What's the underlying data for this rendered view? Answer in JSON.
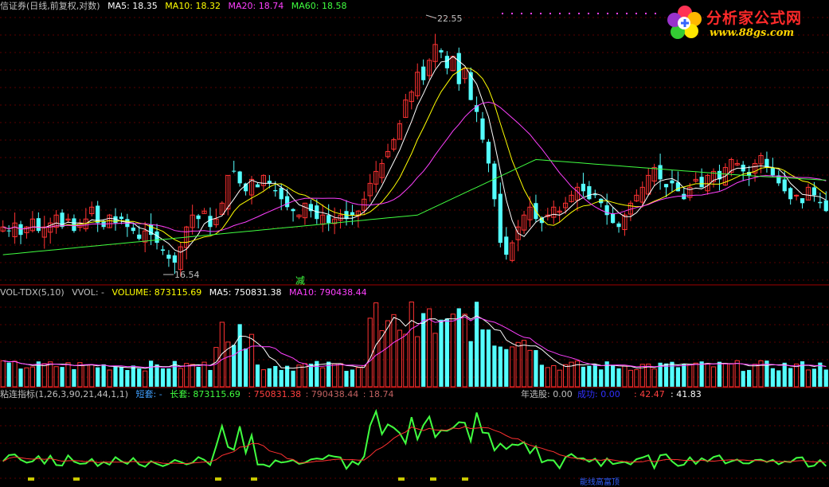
{
  "main_header": {
    "title": "信证券(日线,前复权,对数)",
    "ma5_label": "MA5: 18.35",
    "ma10_label": "MA10: 18.32",
    "ma20_label": "MA20: 18.74",
    "ma60_label": "MA60: 18.58",
    "colors": {
      "title": "#c0c0c0",
      "ma5": "#ffffff",
      "ma10": "#ffff00",
      "ma20": "#ff40ff",
      "ma60": "#40ff40"
    }
  },
  "price_annotations": {
    "high": "22.55",
    "low": "16.54",
    "signal": "减"
  },
  "vol_header": {
    "title": "VOL-TDX(5,10)",
    "vvol": "VVOL: -",
    "volume": "VOLUME: 873115.69",
    "ma5": "MA5: 750831.38",
    "ma10": "MA10: 790438.44"
  },
  "ind_header": {
    "title": "粘连指标(1,26,3,90,21,44,1,1)",
    "short": "短套: -",
    "long": "长套: 873115.69",
    "v1": ": 750831.38",
    "v2": ": 790438.44",
    "v3": ": 18.74",
    "year_pick": "年选股: 0.00",
    "success": "成功: 0.00",
    "v4": ": 42.47",
    "v5": ": 41.83"
  },
  "bottom_label": "能线高富顶",
  "logo": {
    "name": "分析家公式网",
    "url": "www.88gs.com"
  },
  "chart_data": [
    {
      "type": "candlestick",
      "title": "信证券(日线,前复权,对数)",
      "annotations": [
        "22.55",
        "16.54",
        "减"
      ],
      "ylim": [
        16.2,
        23.0
      ],
      "x": "trading days 1-160",
      "closes": [
        17.6,
        17.5,
        17.7,
        17.4,
        17.6,
        17.8,
        17.5,
        17.6,
        17.7,
        17.9,
        17.6,
        17.8,
        17.5,
        17.7,
        17.8,
        18.1,
        17.7,
        17.6,
        17.9,
        17.7,
        17.8,
        17.6,
        17.5,
        17.3,
        17.5,
        17.4,
        17.2,
        17.0,
        16.8,
        16.7,
        17.1,
        17.6,
        17.9,
        17.8,
        18.0,
        17.6,
        17.8,
        18.2,
        18.9,
        19.0,
        18.7,
        18.5,
        18.8,
        18.6,
        18.9,
        18.7,
        18.5,
        18.3,
        18.1,
        18.0,
        17.9,
        18.2,
        18.0,
        17.8,
        17.9,
        17.7,
        17.8,
        17.9,
        17.8,
        17.9,
        18.0,
        18.3,
        18.7,
        19.0,
        19.2,
        19.5,
        19.8,
        20.2,
        20.8,
        21.0,
        21.5,
        21.3,
        21.8,
        22.2,
        22.0,
        21.6,
        21.9,
        21.2,
        21.6,
        20.8,
        20.5,
        19.8,
        19.2,
        18.3,
        17.2,
        16.9,
        17.2,
        17.6,
        17.9,
        18.1,
        17.8,
        17.7,
        17.9,
        18.1,
        18.0,
        18.2,
        18.4,
        18.6,
        18.5,
        18.3,
        18.4,
        18.2,
        17.9,
        17.7,
        17.6,
        17.9,
        18.2,
        18.4,
        18.6,
        18.9,
        19.1,
        18.8,
        18.6,
        18.7,
        18.5,
        18.3,
        18.6,
        18.8,
        18.6,
        18.9,
        19.0,
        18.8,
        19.1,
        19.3,
        19.2,
        19.0,
        18.9,
        19.2,
        19.4,
        19.1,
        18.9,
        18.7,
        18.5,
        18.3,
        18.4,
        18.2,
        18.6,
        18.4,
        18.2,
        18.0
      ],
      "ma60_trend": "rising from 16.9 to 19.3 then 18.6"
    },
    {
      "type": "bar",
      "title": "VOL-TDX(5,10)",
      "series": [
        {
          "name": "VOLUME",
          "last": 873115.69
        },
        {
          "name": "MA5",
          "last": 750831.38
        },
        {
          "name": "MA10",
          "last": 790438.44
        }
      ]
    },
    {
      "type": "line",
      "title": "粘连指标(1,26,3,90,21,44,1,1)",
      "series": [
        {
          "name": "长套",
          "color": "#40ff40"
        },
        {
          "name": "signal",
          "color": "#ff3030"
        }
      ]
    }
  ]
}
